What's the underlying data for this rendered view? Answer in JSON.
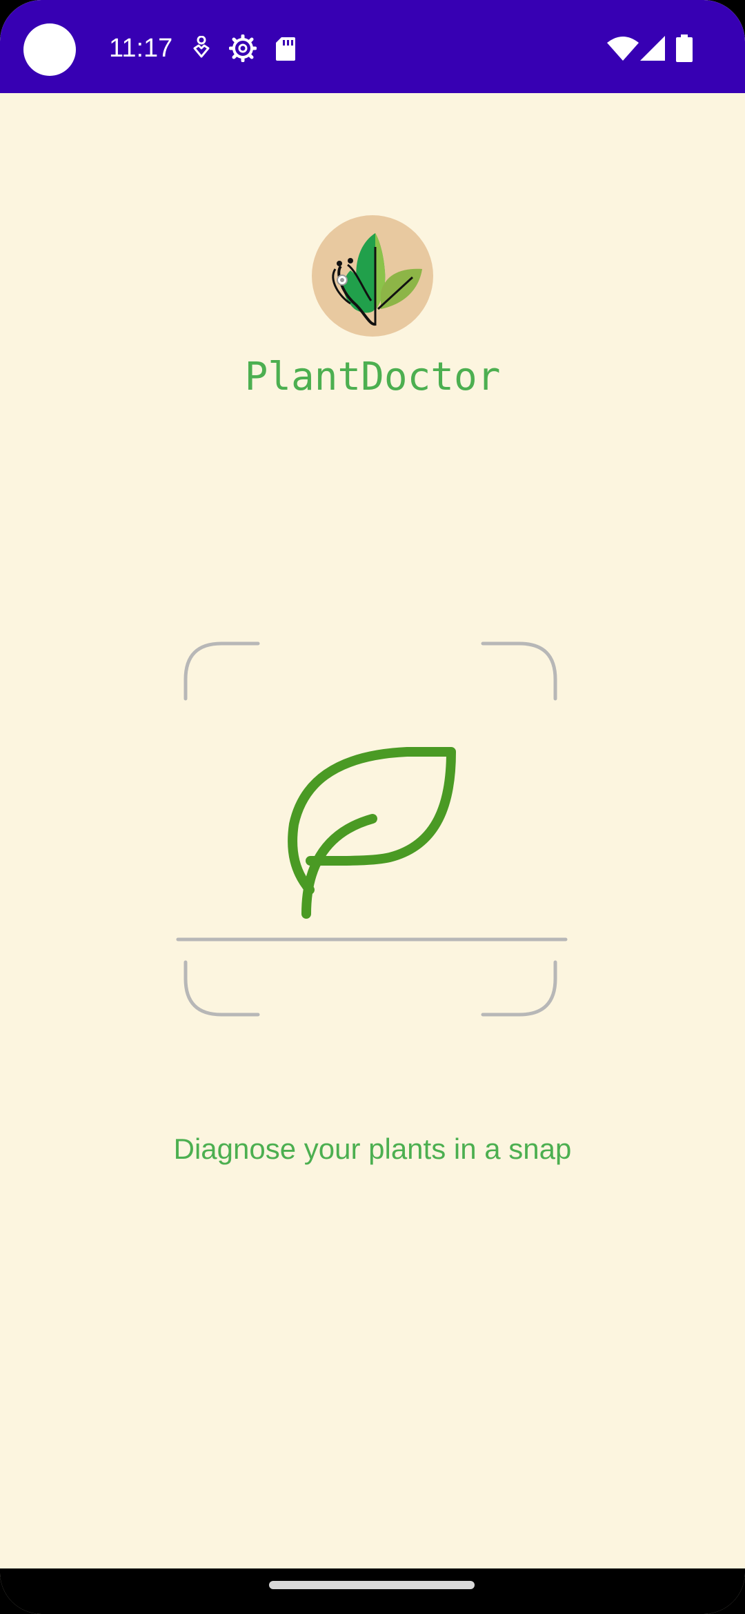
{
  "status_bar": {
    "time": "11:17",
    "icons": [
      "accessibility-icon",
      "settings-gear-icon",
      "sd-card-icon",
      "wifi-icon",
      "cell-signal-icon",
      "battery-icon"
    ],
    "background": "#3700B3"
  },
  "app": {
    "title": "PlantDoctor",
    "tagline": "Diagnose your plants in a snap",
    "logo_icon": "plant-stethoscope-logo-icon",
    "scan_icon": "leaf-scan-icon"
  },
  "colors": {
    "background": "#FCF5DF",
    "accent_green": "#4CAF50",
    "leaf_green": "#4A9A24",
    "scanner_gray": "#B7B7B7",
    "logo_circle": "#E8C9A0"
  }
}
